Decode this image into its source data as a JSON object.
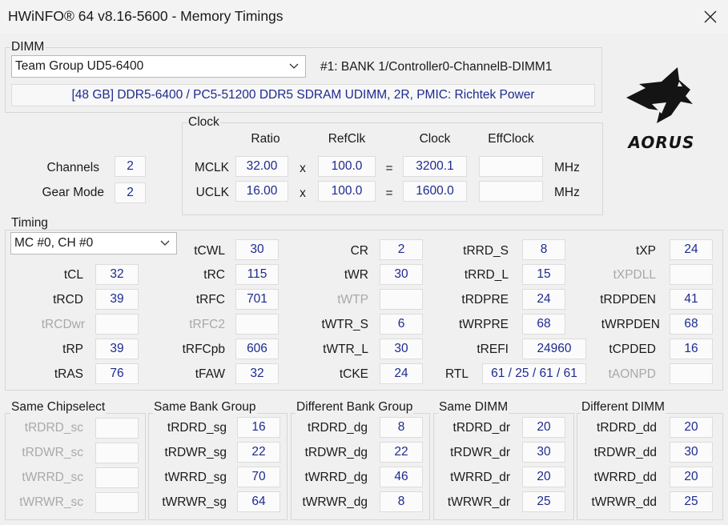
{
  "window": {
    "title": "HWiNFO® 64 v8.16-5600 - Memory Timings"
  },
  "dimm": {
    "group_label": "DIMM",
    "selected_module": "Team Group UD5-6400",
    "slot": "#1: BANK 1/Controller0-ChannelB-DIMM1",
    "description": "[48 GB] DDR5-6400 / PC5-51200 DDR5 SDRAM UDIMM, 2R, PMIC: Richtek Power"
  },
  "channels": {
    "label": "Channels",
    "value": "2"
  },
  "gear_mode": {
    "label": "Gear Mode",
    "value": "2"
  },
  "clock": {
    "group_label": "Clock",
    "headers": {
      "ratio": "Ratio",
      "refclk": "RefClk",
      "clock": "Clock",
      "effclock": "EffClock"
    },
    "times": "x",
    "equals": "=",
    "unit": "MHz",
    "mclk": {
      "label": "MCLK",
      "ratio": "32.00",
      "refclk": "100.0",
      "clock": "3200.1",
      "effclock": ""
    },
    "uclk": {
      "label": "UCLK",
      "ratio": "16.00",
      "refclk": "100.0",
      "clock": "1600.0",
      "effclock": ""
    }
  },
  "logo": {
    "text": "AORUS",
    "icon": "aorus-eagle-logo"
  },
  "timing": {
    "group_label": "Timing",
    "selected_channel": "MC #0, CH #0",
    "col1": [
      {
        "label": "tCL",
        "value": "32"
      },
      {
        "label": "tRCD",
        "value": "39"
      },
      {
        "label": "tRCDwr",
        "value": ""
      },
      {
        "label": "tRP",
        "value": "39"
      },
      {
        "label": "tRAS",
        "value": "76"
      }
    ],
    "col2": [
      {
        "label": "tCWL",
        "value": "30"
      },
      {
        "label": "tRC",
        "value": "115"
      },
      {
        "label": "tRFC",
        "value": "701"
      },
      {
        "label": "tRFC2",
        "value": ""
      },
      {
        "label": "tRFCpb",
        "value": "606"
      },
      {
        "label": "tFAW",
        "value": "32"
      }
    ],
    "col3": [
      {
        "label": "CR",
        "value": "2"
      },
      {
        "label": "tWR",
        "value": "30"
      },
      {
        "label": "tWTP",
        "value": ""
      },
      {
        "label": "tWTR_S",
        "value": "6"
      },
      {
        "label": "tWTR_L",
        "value": "30"
      },
      {
        "label": "tCKE",
        "value": "24"
      }
    ],
    "col4": [
      {
        "label": "tRRD_S",
        "value": "8"
      },
      {
        "label": "tRRD_L",
        "value": "15"
      },
      {
        "label": "tRDPRE",
        "value": "24"
      },
      {
        "label": "tWRPRE",
        "value": "68"
      },
      {
        "label": "tREFI",
        "value": "24960"
      },
      {
        "label": "RTL",
        "value": "61 / 25 / 61 / 61"
      }
    ],
    "col5": [
      {
        "label": "tXP",
        "value": "24"
      },
      {
        "label": "tXPDLL",
        "value": ""
      },
      {
        "label": "tRDPDEN",
        "value": "41"
      },
      {
        "label": "tWRPDEN",
        "value": "68"
      },
      {
        "label": "tCPDED",
        "value": "16"
      },
      {
        "label": "tAONPD",
        "value": ""
      }
    ]
  },
  "groups": {
    "same_chipselect": {
      "label": "Same Chipselect",
      "items": [
        {
          "label": "tRDRD_sc",
          "value": ""
        },
        {
          "label": "tRDWR_sc",
          "value": ""
        },
        {
          "label": "tWRRD_sc",
          "value": ""
        },
        {
          "label": "tWRWR_sc",
          "value": ""
        }
      ]
    },
    "same_bank_group": {
      "label": "Same Bank Group",
      "items": [
        {
          "label": "tRDRD_sg",
          "value": "16"
        },
        {
          "label": "tRDWR_sg",
          "value": "22"
        },
        {
          "label": "tWRRD_sg",
          "value": "70"
        },
        {
          "label": "tWRWR_sg",
          "value": "64"
        }
      ]
    },
    "different_bank_group": {
      "label": "Different Bank Group",
      "items": [
        {
          "label": "tRDRD_dg",
          "value": "8"
        },
        {
          "label": "tRDWR_dg",
          "value": "22"
        },
        {
          "label": "tWRRD_dg",
          "value": "46"
        },
        {
          "label": "tWRWR_dg",
          "value": "8"
        }
      ]
    },
    "same_dimm": {
      "label": "Same DIMM",
      "items": [
        {
          "label": "tRDRD_dr",
          "value": "20"
        },
        {
          "label": "tRDWR_dr",
          "value": "30"
        },
        {
          "label": "tWRRD_dr",
          "value": "20"
        },
        {
          "label": "tWRWR_dr",
          "value": "25"
        }
      ]
    },
    "different_dimm": {
      "label": "Different DIMM",
      "items": [
        {
          "label": "tRDRD_dd",
          "value": "20"
        },
        {
          "label": "tRDWR_dd",
          "value": "30"
        },
        {
          "label": "tWRRD_dd",
          "value": "20"
        },
        {
          "label": "tWRWR_dd",
          "value": "25"
        }
      ]
    }
  },
  "colors": {
    "value_text": "#1d2a90",
    "disabled_text": "#a9a9a9",
    "background": "#f0f0f0"
  }
}
